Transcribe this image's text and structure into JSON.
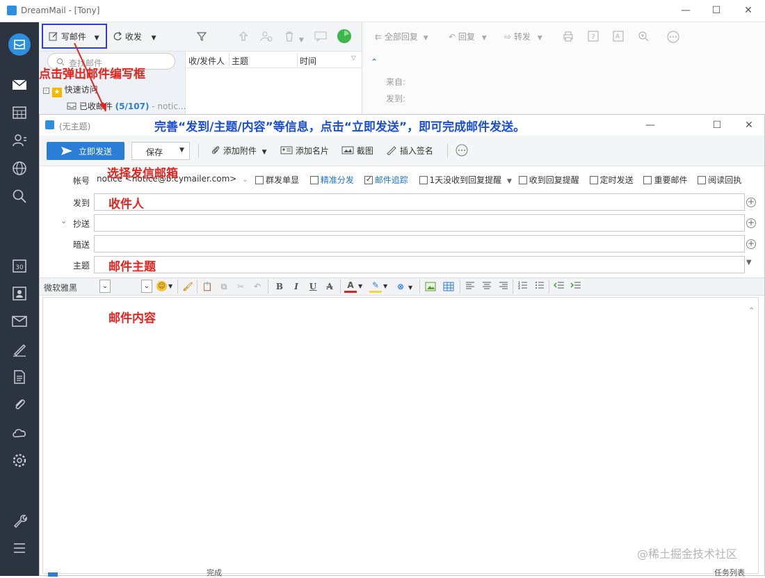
{
  "main_window": {
    "title": "DreamMail - [Tony]",
    "toolbar": {
      "compose_label": "写邮件",
      "receive_label": "收发",
      "reply_all_label": "全部回复",
      "reply_label": "回复",
      "forward_label": "转发"
    },
    "search_placeholder": "查找邮件",
    "folders": {
      "quick_access": "快速访问",
      "inbox_label": "已收邮件",
      "inbox_count": "(5/107)",
      "inbox_account": "- notic..."
    },
    "list_headers": [
      "收/发件人",
      "主题",
      "时间"
    ],
    "read_pane": {
      "from_label": "来自:",
      "to_label": "发到:"
    }
  },
  "compose_window": {
    "title": "(无主题)",
    "toolbar": {
      "send_label": "立即发送",
      "save_label": "保存",
      "attach_label": "添加附件",
      "card_label": "添加名片",
      "screenshot_label": "截图",
      "signature_label": "插入签名"
    },
    "account": {
      "label": "帐号",
      "value": "notice <notice@b.cymailer.com>"
    },
    "options": [
      {
        "label": "群发单显",
        "checked": false,
        "color": "#333333"
      },
      {
        "label": "精准分发",
        "checked": false,
        "color": "#1a73c9"
      },
      {
        "label": "邮件追踪",
        "checked": true,
        "color": "#1a73c9"
      },
      {
        "label": "1天没收到回复提醒",
        "checked": false,
        "color": "#333333"
      },
      {
        "label": "收到回复提醒",
        "checked": false,
        "color": "#333333"
      },
      {
        "label": "定时发送",
        "checked": false,
        "color": "#333333"
      },
      {
        "label": "重要邮件",
        "checked": false,
        "color": "#333333"
      },
      {
        "label": "阅读回执",
        "checked": false,
        "color": "#333333"
      }
    ],
    "fields": {
      "to_label": "发到",
      "cc_label": "抄送",
      "bcc_label": "暗送",
      "subject_label": "主题"
    },
    "format": {
      "font_value": "微软雅黑"
    }
  },
  "annotations": {
    "compose_hint": "点击弹出邮件编写框",
    "instruction": "完善“发到/主题/内容”等信息，点击“立即发送”，即可完成邮件发送。",
    "account_hint": "选择发信邮箱",
    "recipient_hint": "收件人",
    "subject_hint": "邮件主题",
    "content_hint": "邮件内容"
  },
  "status_bar": {
    "left_text": "完成",
    "right_text": "任务列表"
  },
  "watermark": "@稀土掘金技术社区",
  "colors": {
    "accent": "#2b7ed6",
    "sidebar": "#2c3440",
    "annotation_red": "#e8231d",
    "annotation_blue": "#1a4ed6"
  }
}
